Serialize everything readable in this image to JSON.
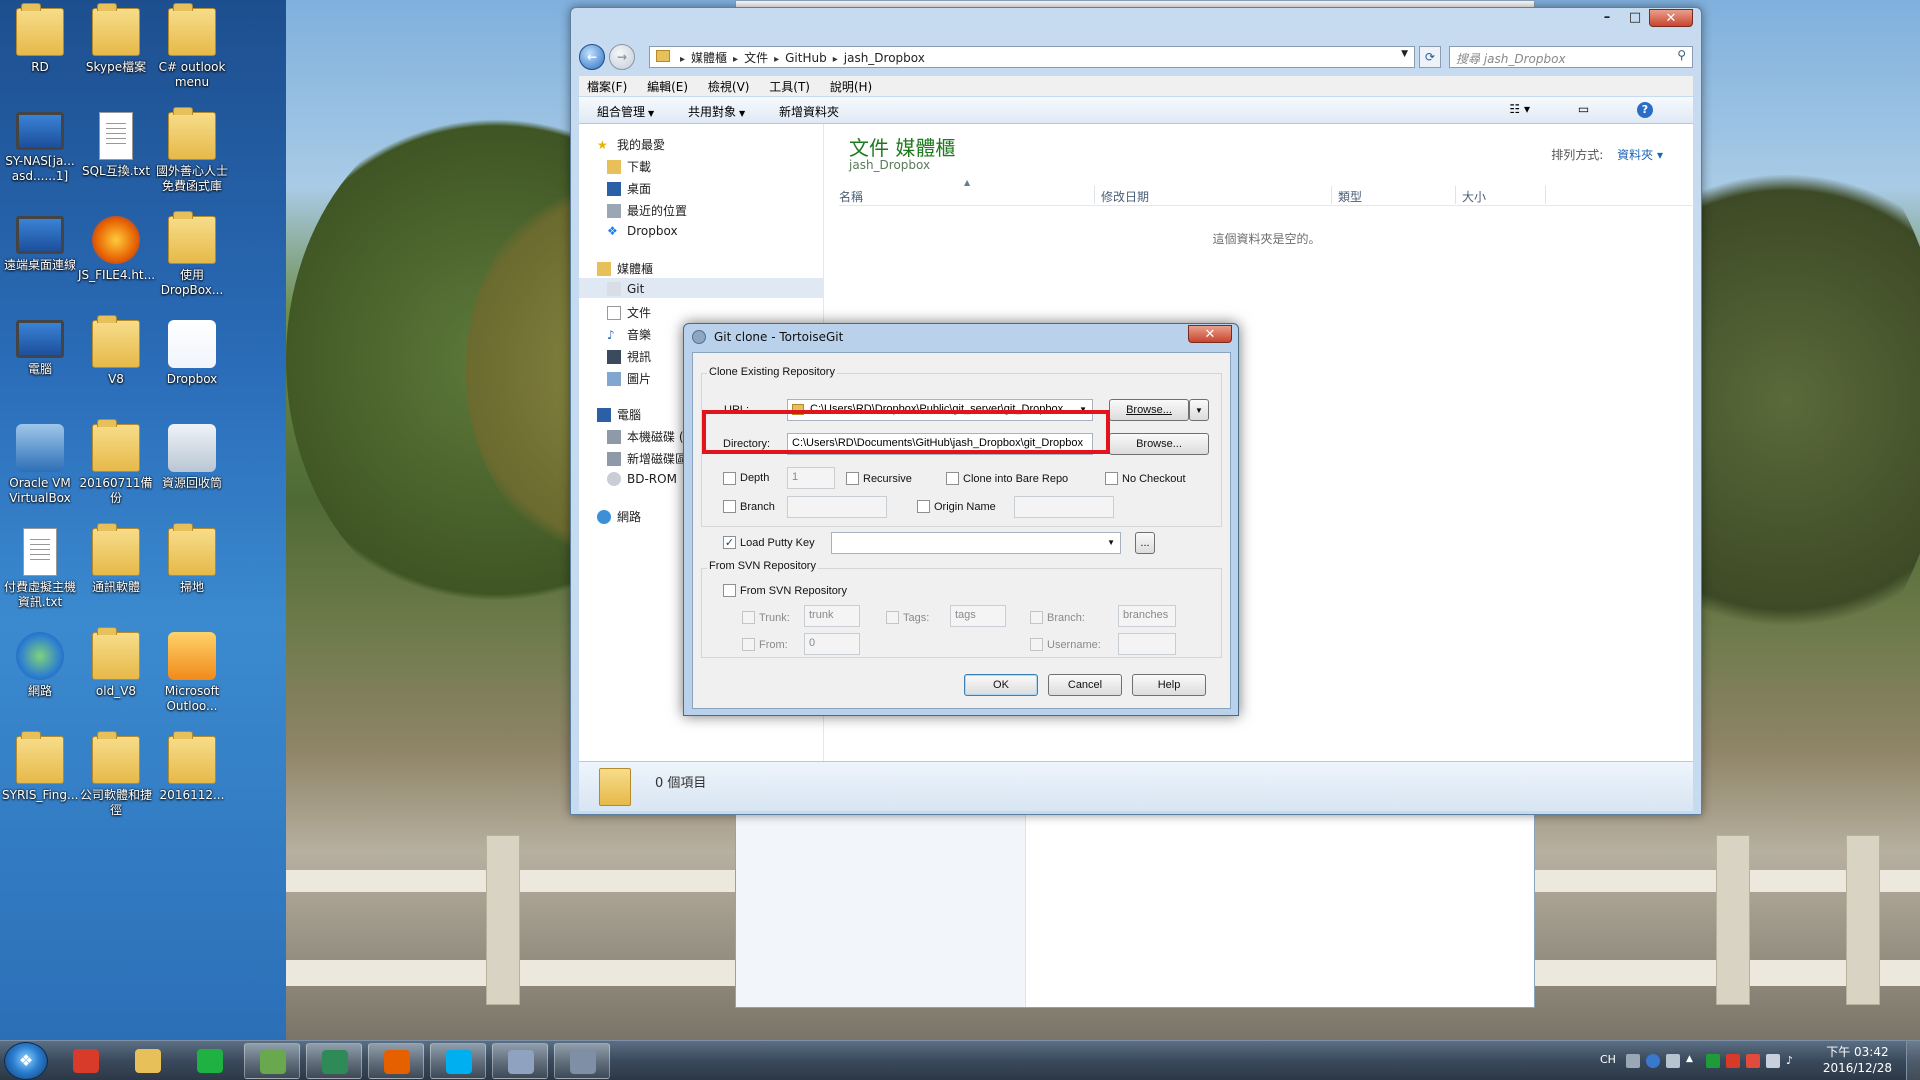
{
  "desktop": {
    "icons": [
      {
        "label": "RD",
        "kind": "folder"
      },
      {
        "label": "Skype檔案",
        "kind": "folder"
      },
      {
        "label": "C# outlook menu",
        "kind": "folder"
      },
      {
        "label": "SY-NAS[ja... asd......1]",
        "kind": "monitor"
      },
      {
        "label": "SQL互換.txt",
        "kind": "doc"
      },
      {
        "label": "國外善心人士免費函式庫",
        "kind": "folder"
      },
      {
        "label": "遠端桌面連線",
        "kind": "monitor"
      },
      {
        "label": "JS_FILE4.ht...",
        "kind": "firefox"
      },
      {
        "label": "使用 DropBox...",
        "kind": "folder"
      },
      {
        "label": "電腦",
        "kind": "monitor"
      },
      {
        "label": "V8",
        "kind": "folder"
      },
      {
        "label": "Dropbox",
        "kind": "dropbox"
      },
      {
        "label": "Oracle VM VirtualBox",
        "kind": "virtualbox"
      },
      {
        "label": "20160711備份",
        "kind": "folder"
      },
      {
        "label": "資源回收筒",
        "kind": "recycle"
      },
      {
        "label": "付費虛擬主機資訊.txt",
        "kind": "doc"
      },
      {
        "label": "通訊軟體",
        "kind": "folder"
      },
      {
        "label": "掃地",
        "kind": "folder"
      },
      {
        "label": "網路",
        "kind": "globe"
      },
      {
        "label": "old_V8",
        "kind": "folder"
      },
      {
        "label": "Microsoft Outloo...",
        "kind": "outlook"
      },
      {
        "label": "SYRIS_Fing...",
        "kind": "folder"
      },
      {
        "label": "公司軟體和捷徑",
        "kind": "folder"
      },
      {
        "label": "2016112...",
        "kind": "folder"
      }
    ]
  },
  "explorer": {
    "breadcrumb": [
      "媒體櫃",
      "文件",
      "GitHub",
      "jash_Dropbox"
    ],
    "search_placeholder": "搜尋 jash_Dropbox",
    "menu": [
      "檔案(F)",
      "編輯(E)",
      "檢視(V)",
      "工具(T)",
      "說明(H)"
    ],
    "toolbar": {
      "organize": "組合管理",
      "share": "共用對象",
      "new_folder": "新增資料夾"
    },
    "nav": {
      "favorites": "我的最愛",
      "downloads": "下載",
      "desktop": "桌面",
      "recent": "最近的位置",
      "dropbox": "Dropbox",
      "libraries": "媒體櫃",
      "git": "Git",
      "documents": "文件",
      "music": "音樂",
      "videos": "視訊",
      "pictures": "圖片",
      "computer": "電腦",
      "local_disk": "本機磁碟 (",
      "new_volume": "新增磁碟區",
      "bdrom": "BD-ROM",
      "network": "網路"
    },
    "library_title": "文件 媒體櫃",
    "library_subtitle": "jash_Dropbox",
    "arrange_label": "排列方式:",
    "arrange_value": "資料夾",
    "columns": [
      "名稱",
      "修改日期",
      "類型",
      "大小"
    ],
    "empty_message": "這個資料夾是空的。",
    "status_count": "0 個項目"
  },
  "dialog": {
    "title": "Git clone - TortoiseGit",
    "clone_group": "Clone Existing Repository",
    "url_label": "URL:",
    "url_value": "C:\\Users\\RD\\Dropbox\\Public\\git_server\\git_Dropbox",
    "browse_label": "Browse...",
    "directory_label": "Directory:",
    "directory_value": "C:\\Users\\RD\\Documents\\GitHub\\jash_Dropbox\\git_Dropbox",
    "depth_label": "Depth",
    "depth_value": "1",
    "recursive_label": "Recursive",
    "bare_label": "Clone into Bare Repo",
    "no_checkout_label": "No Checkout",
    "branch_label": "Branch",
    "origin_label": "Origin Name",
    "putty_label": "Load Putty Key",
    "putty_browse": "...",
    "svn_group": "From SVN Repository",
    "svn_check_label": "From SVN Repository",
    "trunk_label": "Trunk:",
    "trunk_value": "trunk",
    "tags_label": "Tags:",
    "tags_value": "tags",
    "branch_svn_label": "Branch:",
    "branches_value": "branches",
    "from_label": "From:",
    "from_value": "0",
    "username_label": "Username:",
    "ok": "OK",
    "cancel": "Cancel",
    "help": "Help",
    "highlight_color": "#e0141a"
  },
  "taskbar": {
    "start_glyph": "❖",
    "apps": [
      {
        "name": "chrome",
        "color": "#d93b2b"
      },
      {
        "name": "explorer",
        "color": "#e8c05a"
      },
      {
        "name": "line",
        "color": "#1fb141"
      },
      {
        "name": "notepad",
        "color": "#6aa84f"
      },
      {
        "name": "visual-studio",
        "color": "#2e8b57"
      },
      {
        "name": "firefox",
        "color": "#e66000"
      },
      {
        "name": "skype",
        "color": "#00aff0"
      },
      {
        "name": "paint",
        "color": "#8fa3c0"
      },
      {
        "name": "tortoisegit",
        "color": "#7f8fa6"
      }
    ],
    "lang": "CH",
    "clock_time": "下午 03:42",
    "clock_date": "2016/12/28"
  }
}
